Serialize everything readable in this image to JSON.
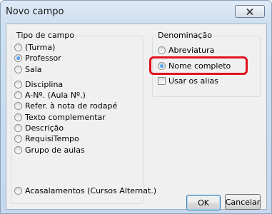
{
  "window": {
    "title": "Novo campo"
  },
  "tipo": {
    "label": "Tipo de campo",
    "options": [
      {
        "label": "(Turma)",
        "selected": false
      },
      {
        "label": "Professor",
        "selected": true
      },
      {
        "label": "Sala",
        "selected": false
      },
      {
        "label": "Disciplina",
        "selected": false
      },
      {
        "label": "A-Nº. (Aula Nº.)",
        "selected": false
      },
      {
        "label": "Refer. à nota de rodapé",
        "selected": false
      },
      {
        "label": "Texto complementar",
        "selected": false
      },
      {
        "label": "Descrição",
        "selected": false
      },
      {
        "label": "RequisiTempo",
        "selected": false
      },
      {
        "label": "Grupo de aulas",
        "selected": false
      },
      {
        "label": "Acasalamentos (Cursos Alternat.)",
        "selected": false
      }
    ]
  },
  "denominacao": {
    "label": "Denominação",
    "options": [
      {
        "label": "Abreviatura",
        "selected": false
      },
      {
        "label": "Nome completo",
        "selected": true
      }
    ],
    "checkbox": {
      "label": "Usar os alias",
      "checked": false
    }
  },
  "buttons": {
    "ok": "OK",
    "cancel": "Cancelar"
  },
  "colors": {
    "highlight": "#e0131e",
    "radio_selected": "#1a6fd1"
  }
}
